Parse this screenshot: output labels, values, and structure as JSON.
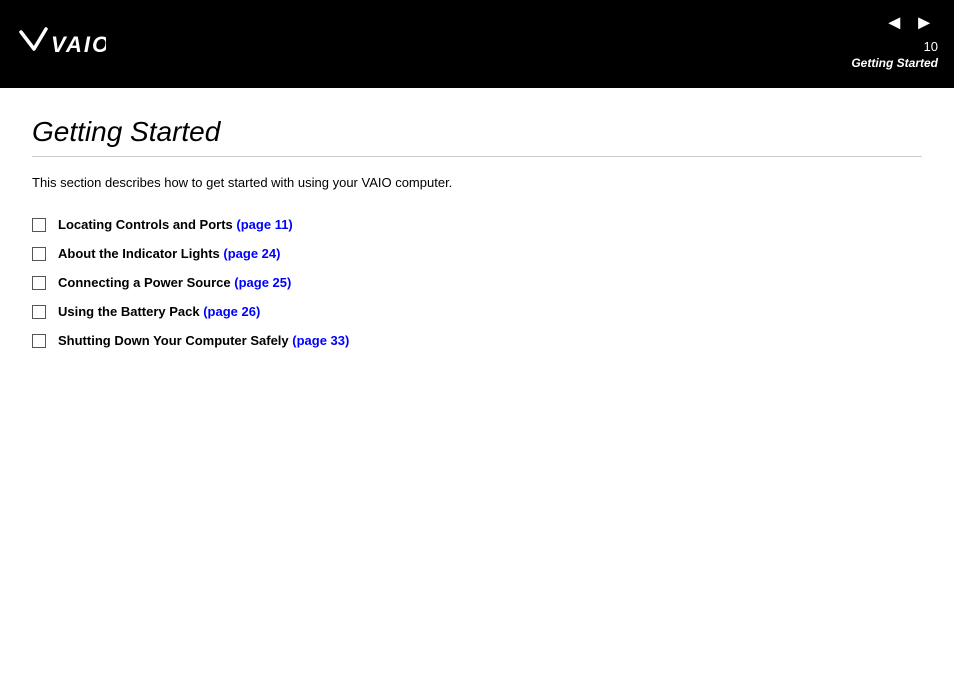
{
  "header": {
    "logo_text": "VAIO",
    "page_number": "10",
    "section_label": "Getting Started",
    "prev_arrow": "◄",
    "next_arrow": "►"
  },
  "main": {
    "title": "Getting Started",
    "intro": "This section describes how to get started with using your VAIO computer.",
    "toc_items": [
      {
        "id": "locating-controls",
        "text": "Locating Controls and Ports",
        "link_text": "(page 11)",
        "link_href": "#page11"
      },
      {
        "id": "indicator-lights",
        "text": "About the Indicator Lights",
        "link_text": "(page 24)",
        "link_href": "#page24"
      },
      {
        "id": "power-source",
        "text": "Connecting a Power Source",
        "link_text": "(page 25)",
        "link_href": "#page25"
      },
      {
        "id": "battery-pack",
        "text": "Using the Battery Pack",
        "link_text": "(page 26)",
        "link_href": "#page26"
      },
      {
        "id": "shutting-down",
        "text": "Shutting Down Your Computer Safely",
        "link_text": "(page 33)",
        "link_href": "#page33"
      }
    ]
  }
}
